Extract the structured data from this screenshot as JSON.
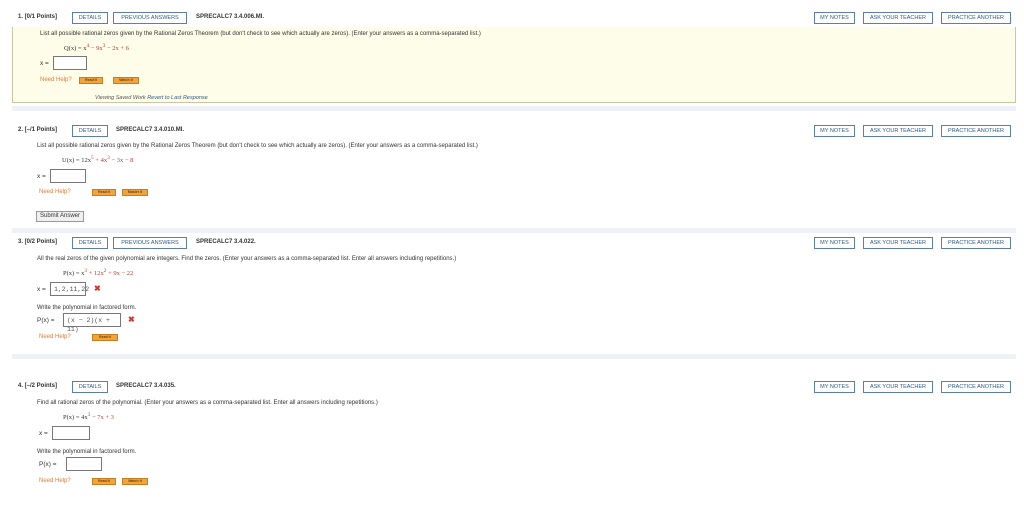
{
  "header_buttons": {
    "details": "DETAILS",
    "previous_answers": "PREVIOUS ANSWERS",
    "my_notes": "MY NOTES",
    "ask_teacher": "ASK YOUR TEACHER",
    "practice_another": "PRACTICE ANOTHER"
  },
  "q1": {
    "num": "1.  [0/1 Points]",
    "code": "SPRECALC7 3.4.006.MI.",
    "prompt": "List all possible rational zeros given by the Rational Zeros Theorem (but don't check to see which actually are zeros). (Enter your answers as a comma-separated list.)",
    "func_lhs": "Q(x) = x",
    "func_exp": "4",
    "func_mid": " − 9x",
    "func_exp2": "3",
    "func_rest": " − 2x + 6",
    "x_label": "x =",
    "answer": "",
    "need_help": "Need Help?",
    "help1": "Read It",
    "help2": "Watch It",
    "saved": "Viewing Saved Work",
    "revert": "Revert to Last Response"
  },
  "q2": {
    "num": "2.  [–/1 Points]",
    "code": "SPRECALC7 3.4.010.MI.",
    "prompt": "List all possible rational zeros given by the Rational Zeros Theorem (but don't check to see which actually are zeros). (Enter your answers as a comma-separated list.)",
    "func_lhs": "U(x) = 12x",
    "func_exp": "5",
    "func_mid": " + 4x",
    "func_exp2": "3",
    "func_rest": " − 3x − 8",
    "x_label": "x =",
    "answer": "",
    "need_help": "Need Help?",
    "help1": "Read It",
    "help2": "Master It",
    "submit": "Submit Answer"
  },
  "q3": {
    "num": "3.  [0/2 Points]",
    "code": "SPRECALC7 3.4.022.",
    "prompt": "All the real zeros of the given polynomial are integers. Find the zeros. (Enter your answers as a comma-separated list. Enter all answers including repetitions.)",
    "func_lhs": "P(x) = x",
    "func_exp": "3",
    "func_mid": " + 12x",
    "func_exp2": "2",
    "func_rest": " + 9x − 22",
    "x_label": "x =",
    "answer": "1,2,11,22",
    "factored_prompt": "Write the polynomial in factored form.",
    "px_label": "P(x) =",
    "factored_answer": "(x − 2)(x + 11)",
    "wrong_mark": "✖",
    "need_help": "Need Help?",
    "help1": "Read It"
  },
  "q4": {
    "num": "4.  [–/2 Points]",
    "code": "SPRECALC7 3.4.035.",
    "prompt": "Find all rational zeros of the polynomial. (Enter your answers as a comma-separated list. Enter all answers including repetitions.)",
    "func_lhs": "P(x) = 4x",
    "func_exp": "3",
    "func_rest": " − 7x + 3",
    "x_label": "x =",
    "answer": "",
    "factored_prompt": "Write the polynomial in factored form.",
    "px_label": "P(x) =",
    "factored_answer": "",
    "need_help": "Need Help?",
    "help1": "Read It",
    "help2": "Watch It"
  }
}
